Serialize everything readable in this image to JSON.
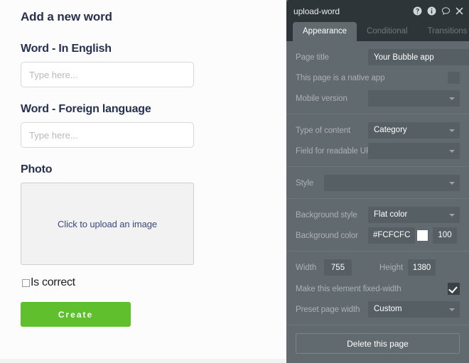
{
  "app_preview": {
    "form_title": "Add a new word",
    "fields": [
      {
        "label": "Word - In English",
        "placeholder": "Type here...",
        "value": ""
      },
      {
        "label": "Word - Foreign language",
        "placeholder": "Type here...",
        "value": ""
      }
    ],
    "photo": {
      "label": "Photo",
      "uploader_text": "Click to upload an image"
    },
    "checkbox": {
      "label": "Is correct",
      "checked": false
    },
    "submit_label": "Create",
    "submit_color": "#5FBF2C",
    "page_background": "#FCFCFC"
  },
  "panel": {
    "title": "upload-word",
    "header_icons": [
      "help-circle-icon",
      "info-circle-icon",
      "comment-bubble-icon",
      "close-icon"
    ],
    "tabs": [
      {
        "label": "Appearance",
        "active": true
      },
      {
        "label": "Conditional",
        "active": false
      },
      {
        "label": "Transitions",
        "active": false
      }
    ],
    "sections": {
      "page": {
        "page_title_label": "Page title",
        "page_title_value": "Your Bubble app",
        "native_app_label": "This page is a native app",
        "native_app_checked": false,
        "mobile_version_label": "Mobile version",
        "mobile_version_value": ""
      },
      "content": {
        "type_of_content_label": "Type of content",
        "type_of_content_value": "Category",
        "readable_url_label": "Field for readable URL",
        "readable_url_value": ""
      },
      "style": {
        "style_label": "Style",
        "style_value": ""
      },
      "background": {
        "background_style_label": "Background style",
        "background_style_value": "Flat color",
        "background_color_label": "Background color",
        "background_color_hex": "#FCFCFC",
        "background_color_swatch": "#FFFFFF",
        "background_color_alpha": "100"
      },
      "dimensions": {
        "width_label": "Width",
        "width_value": "755",
        "height_label": "Height",
        "height_value": "1380",
        "fixed_width_label": "Make this element fixed-width",
        "fixed_width_checked": true,
        "preset_width_label": "Preset page width",
        "preset_width_value": "Custom"
      },
      "actions": {
        "delete_label": "Delete this page"
      }
    }
  }
}
